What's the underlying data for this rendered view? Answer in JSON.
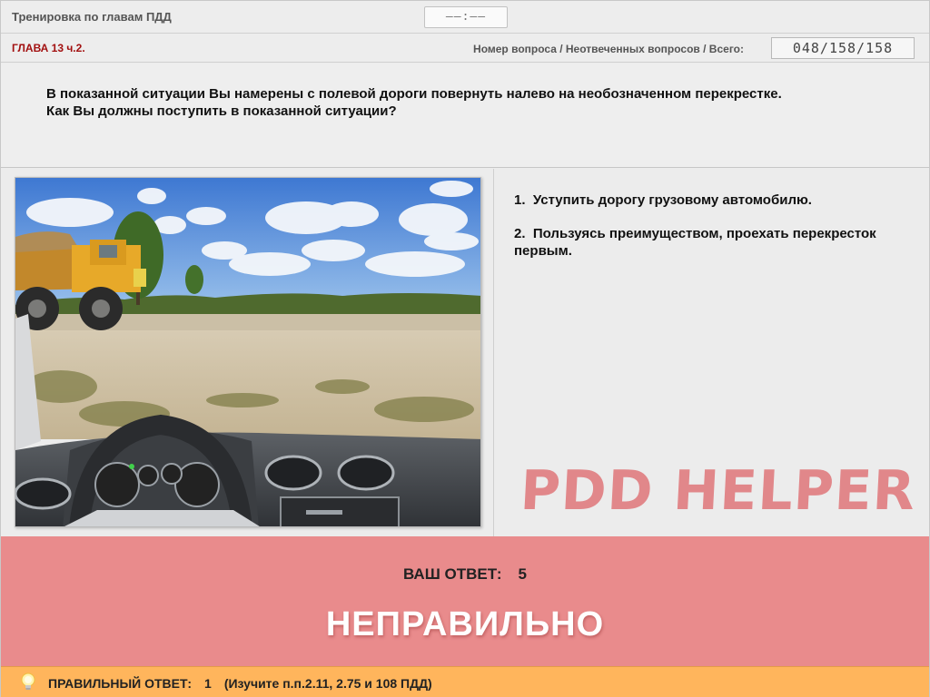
{
  "header": {
    "app_title": "Тренировка по главам ПДД",
    "timer": "——:——"
  },
  "chapter_bar": {
    "chapter": "ГЛАВА 13 ч.2.",
    "counter_label": "Номер вопроса / Неотвеченных вопросов / Всего:",
    "counter": "048/158/158"
  },
  "question": {
    "text": "В показанной ситуации Вы намерены с полевой дороги повернуть налево на необозначенном перекрестке. Как Вы должны поступить в показанной ситуации?"
  },
  "answers": [
    {
      "number": "1.",
      "text": "Уступить дорогу грузовому автомобилю."
    },
    {
      "number": "2.",
      "text": "Пользуясь преимуществом, проехать перекресток первым."
    }
  ],
  "watermark": "PDD HELPER",
  "result": {
    "your_answer_label": "ВАШ  ОТВЕТ:",
    "your_answer_value": "5",
    "verdict": "НЕПРАВИЛЬНО",
    "background_color": "#e98b8c"
  },
  "footer": {
    "icon": "lightbulb-icon",
    "correct_label": "ПРАВИЛЬНЫЙ ОТВЕТ:",
    "correct_value": "1",
    "hint": "(Изучите п.п.2.11, 2.75 и 108 ПДД)",
    "background_color": "#ffb55c"
  }
}
